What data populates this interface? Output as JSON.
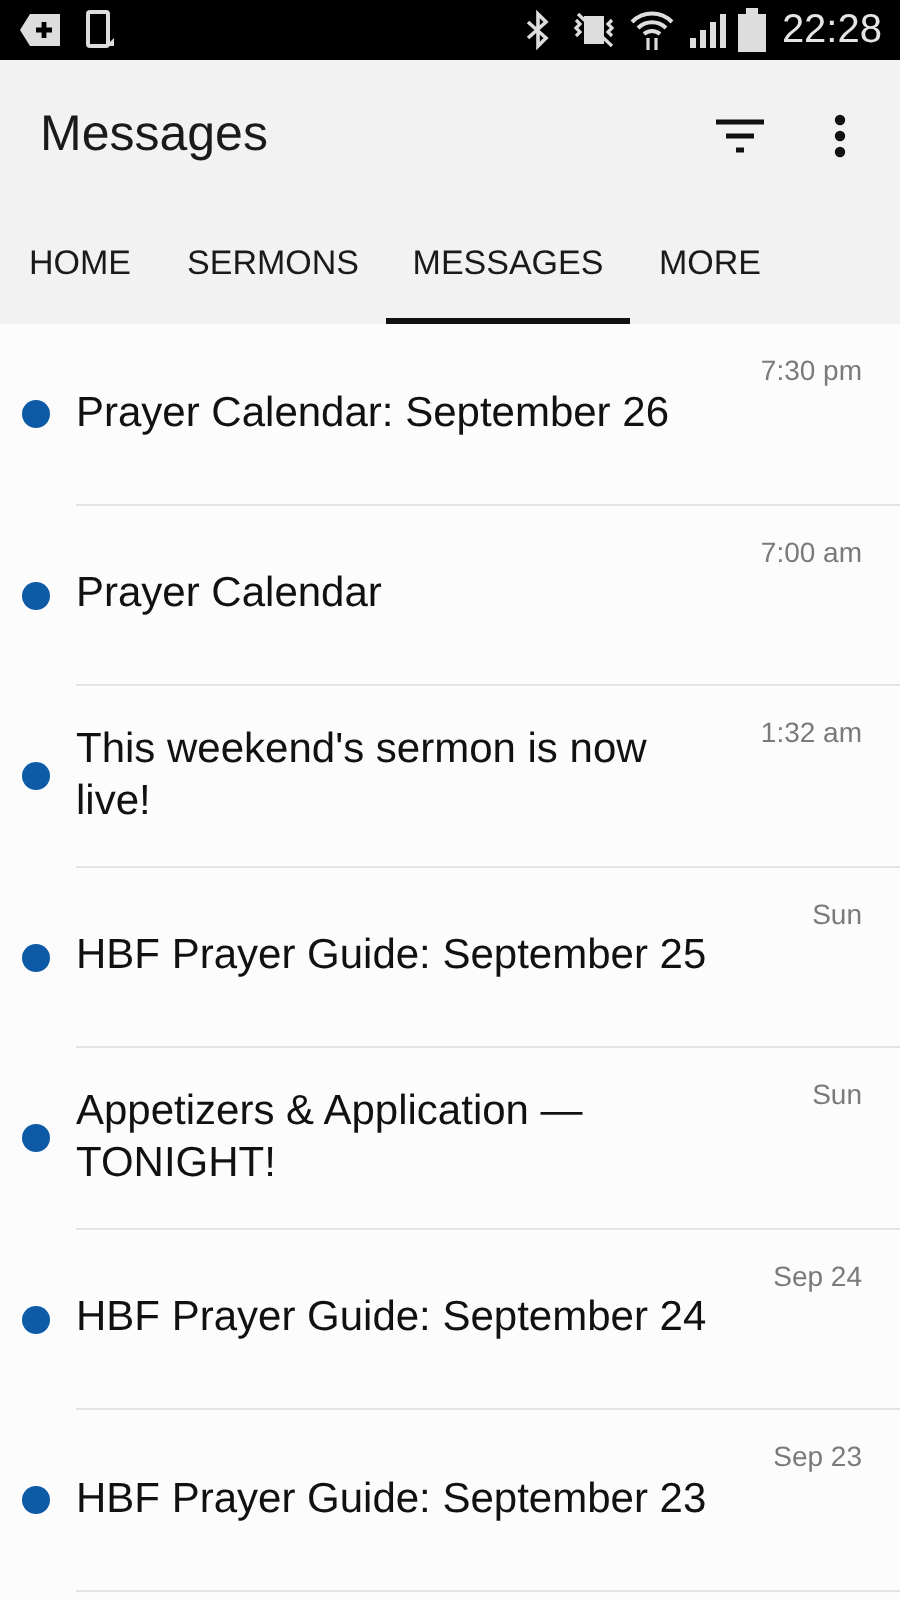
{
  "status_bar": {
    "time": "22:28"
  },
  "app_bar": {
    "title": "Messages"
  },
  "tabs": [
    {
      "label": "HOME",
      "selected": false
    },
    {
      "label": "SERMONS",
      "selected": false
    },
    {
      "label": "MESSAGES",
      "selected": true
    },
    {
      "label": "MORE",
      "selected": false
    }
  ],
  "messages": [
    {
      "title": "Prayer Calendar: September 26",
      "time": "7:30 pm",
      "unread": true
    },
    {
      "title": "Prayer Calendar",
      "time": "7:00 am",
      "unread": true
    },
    {
      "title": "This weekend's sermon is now live!",
      "time": "1:32 am",
      "unread": true
    },
    {
      "title": "HBF Prayer Guide: September 25",
      "time": "Sun",
      "unread": true
    },
    {
      "title": "Appetizers & Application — TONIGHT!",
      "time": "Sun",
      "unread": true
    },
    {
      "title": "HBF Prayer Guide: September 24",
      "time": "Sep 24",
      "unread": true
    },
    {
      "title": "HBF Prayer Guide: September 23",
      "time": "Sep 23",
      "unread": true
    }
  ]
}
